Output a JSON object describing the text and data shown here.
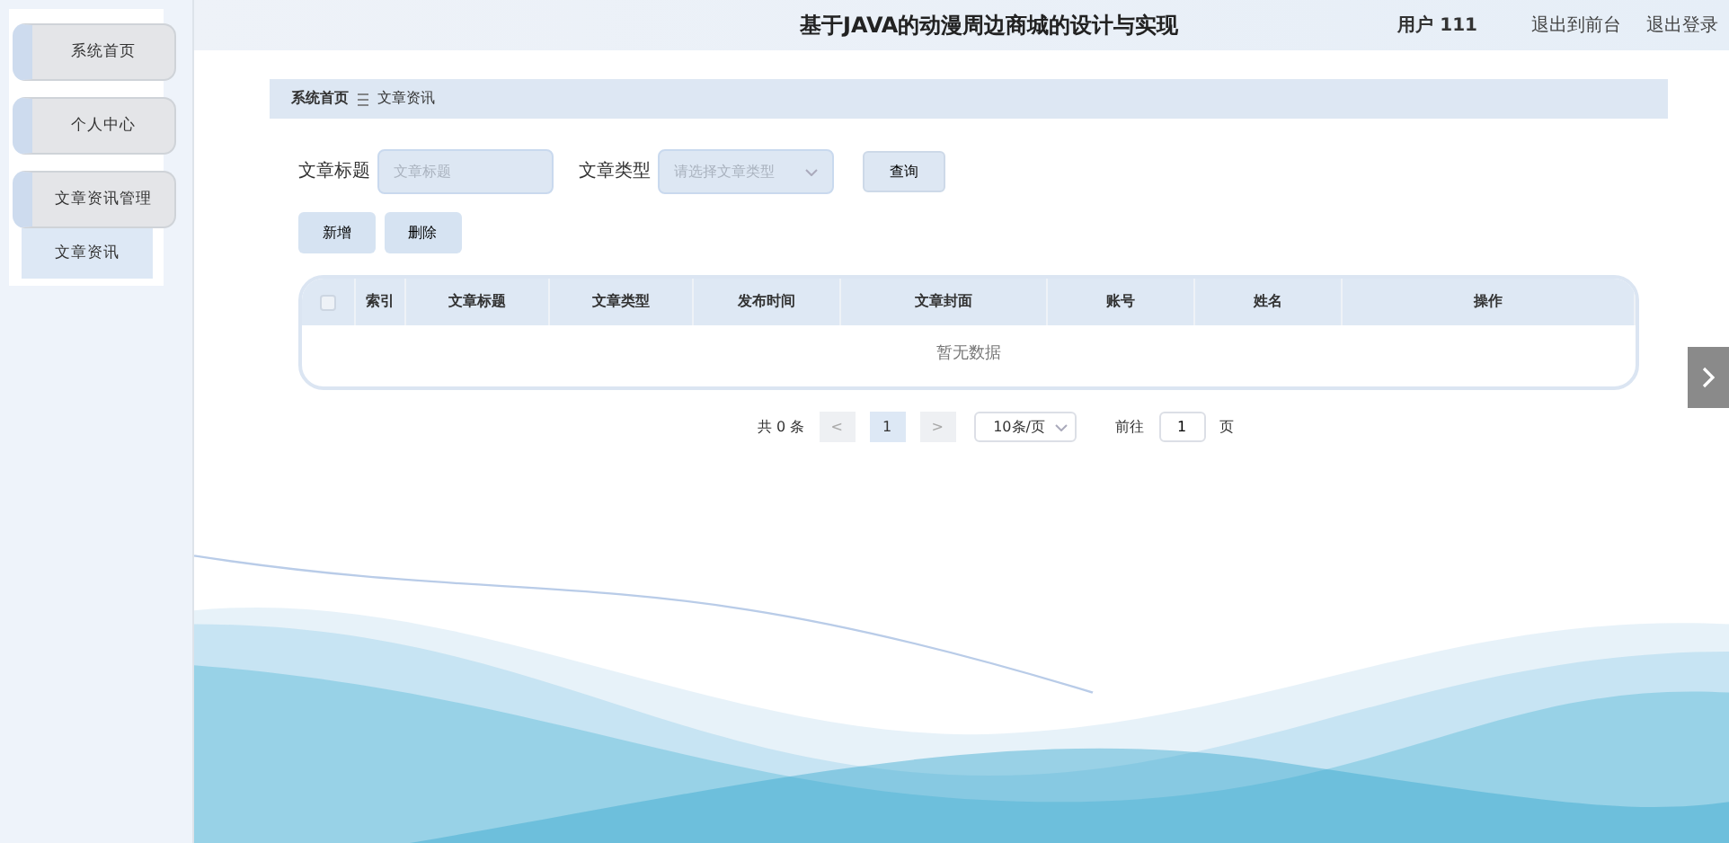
{
  "header": {
    "title": "基于JAVA的动漫周边商城的设计与实现",
    "user": "用户 111",
    "links": [
      "退出到前台",
      "退出登录"
    ]
  },
  "sidebar": {
    "items": [
      {
        "label": "系统首页"
      },
      {
        "label": "个人中心"
      },
      {
        "label": "文章资讯管理",
        "children": [
          {
            "label": "文章资讯",
            "selected": true
          }
        ]
      }
    ]
  },
  "breadcrumb": [
    "系统首页",
    "文章资讯"
  ],
  "search": {
    "fields": [
      {
        "label": "文章标题",
        "kind": "text",
        "placeholder": "文章标题"
      },
      {
        "label": "文章类型",
        "kind": "select",
        "placeholder": "请选择文章类型"
      }
    ],
    "button": "查询"
  },
  "actions": [
    "新增",
    "删除"
  ],
  "table": {
    "select_all_checked": false,
    "columns": [
      "索引",
      "文章标题",
      "文章类型",
      "发布时间",
      "文章封面",
      "账号",
      "姓名",
      "操作"
    ],
    "empty_text": "暂无数据"
  },
  "pagination": {
    "total": "共 0 条",
    "prev": "<",
    "pages": [
      {
        "label": "1",
        "selected": true
      }
    ],
    "next": ">",
    "page_size": "10条/页",
    "goto_label": "前往",
    "goto_value": "1",
    "page_unit": "页"
  }
}
